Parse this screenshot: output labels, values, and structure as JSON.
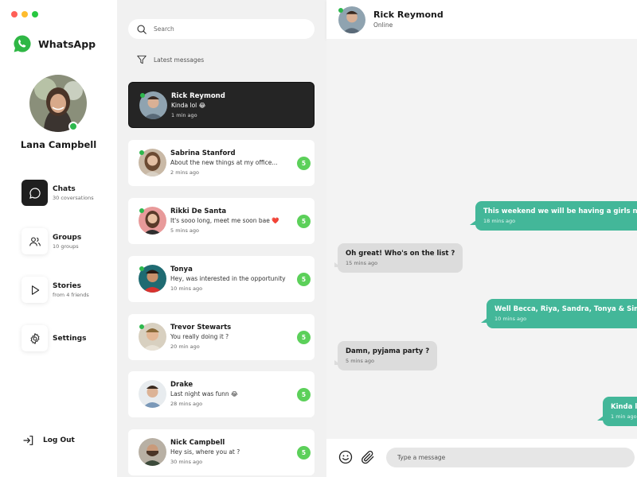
{
  "app": {
    "name": "WhatsApp"
  },
  "profile": {
    "name": "Lana Campbell"
  },
  "nav": [
    {
      "title": "Chats",
      "sub": "30 coversations"
    },
    {
      "title": "Groups",
      "sub": "10 groups"
    },
    {
      "title": "Stories",
      "sub": "from 4 friends"
    },
    {
      "title": "Settings",
      "sub": ""
    }
  ],
  "logout_label": "Log Out",
  "search": {
    "placeholder": "Search"
  },
  "filter_label": "Latest messages",
  "chats": [
    {
      "name": "Rick Reymond",
      "message": "Kinda lol 😂",
      "time": "1 min ago",
      "badge": ""
    },
    {
      "name": "Sabrina Stanford",
      "message": "About the new things at my office...",
      "time": "2 mins ago",
      "badge": "5"
    },
    {
      "name": "Rikki De Santa",
      "message": "It's sooo long, meet me soon bae ❤️",
      "time": "5 mins ago",
      "badge": "5"
    },
    {
      "name": "Tonya",
      "message": "Hey, was interested in the opportunity",
      "time": "10 mins ago",
      "badge": "5"
    },
    {
      "name": "Trevor Stewarts",
      "message": "You really doing it ?",
      "time": "20 min ago",
      "badge": "5"
    },
    {
      "name": "Drake",
      "message": "Last night was funn 😂",
      "time": "28 mins ago",
      "badge": "5"
    },
    {
      "name": "Nick Campbell",
      "message": "Hey sis, where you at ?",
      "time": "30 mins ago",
      "badge": "5"
    }
  ],
  "conversation": {
    "name": "Rick Reymond",
    "status": "Online",
    "messages": [
      {
        "text": "This weekend we will be having a girls night",
        "time": "18 mins ago",
        "dir": "out"
      },
      {
        "text": "Oh great! Who's on the list ?",
        "time": "15 mins ago",
        "dir": "in"
      },
      {
        "text": "Well Becca, Riya, Sandra, Tonya & Simi",
        "time": "10 mins ago",
        "dir": "out"
      },
      {
        "text": "Damn, pyjama party ?",
        "time": "5 mins ago",
        "dir": "in"
      },
      {
        "text": "Kinda lol 😂",
        "time": "1 min ago",
        "dir": "out"
      }
    ]
  },
  "composer": {
    "placeholder": "Type a message"
  },
  "colors": {
    "accent": "#43b799",
    "badge": "#5cd05a",
    "online": "#2db84d",
    "active_card": "#252525"
  }
}
